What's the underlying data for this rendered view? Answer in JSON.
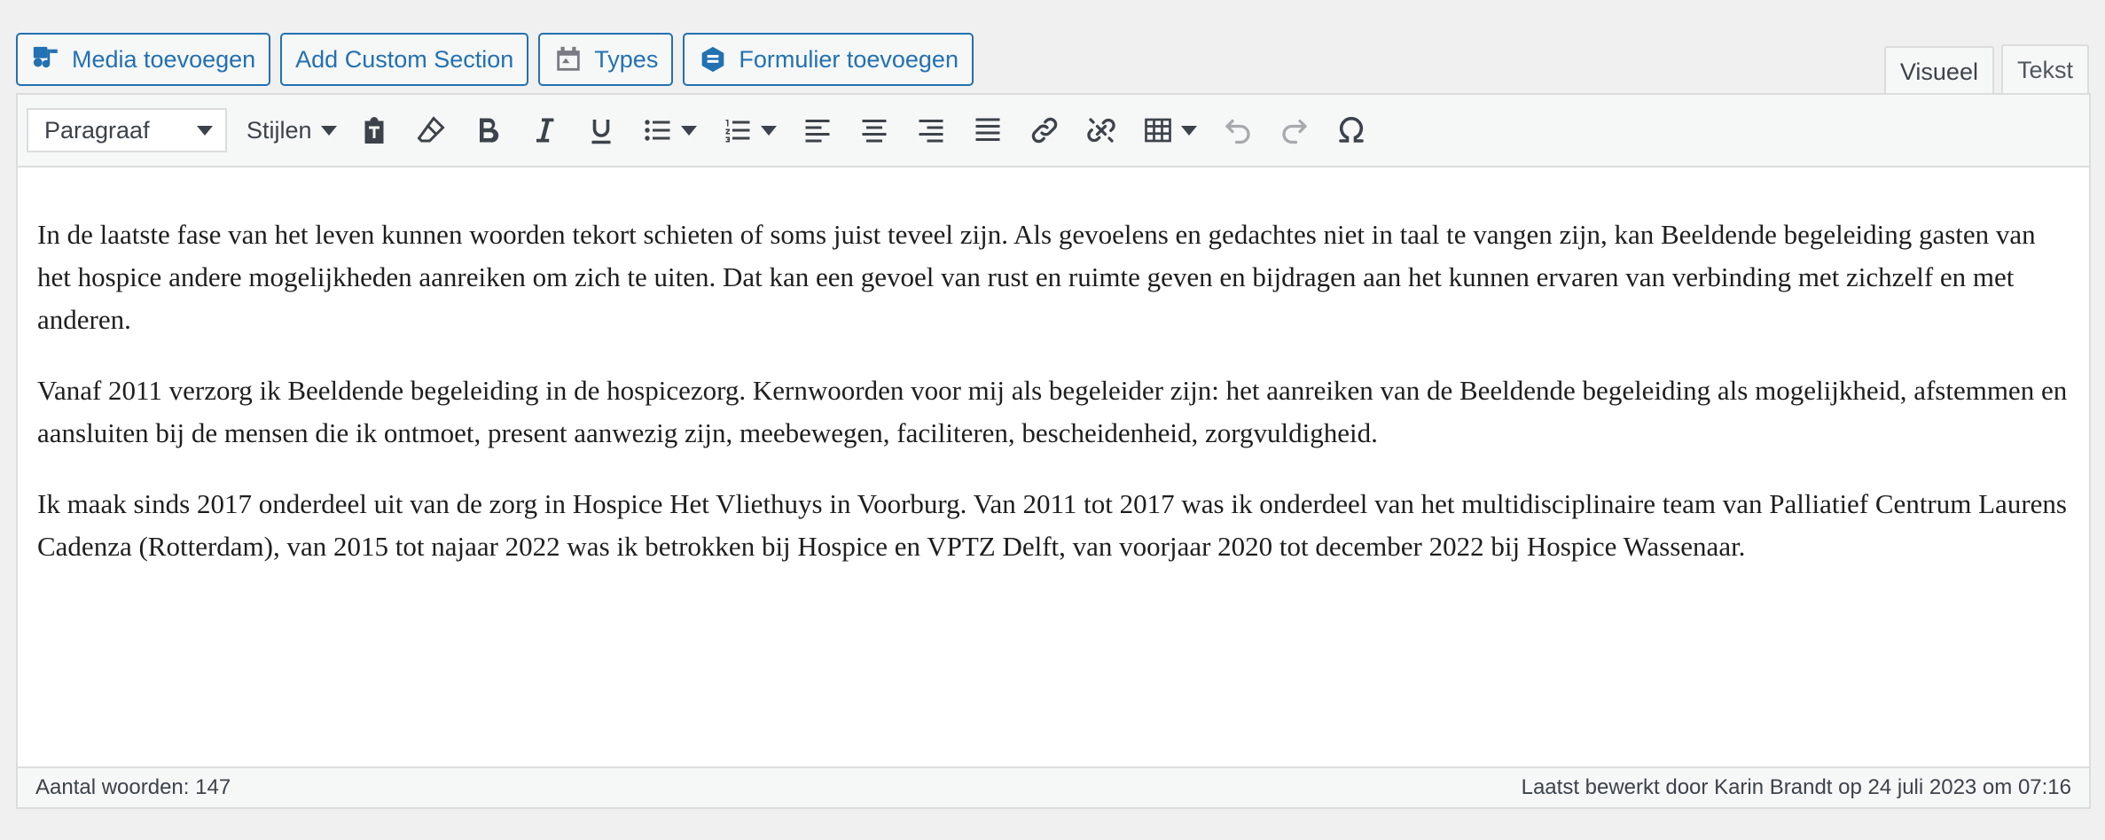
{
  "media_buttons": {
    "add_media": "Media toevoegen",
    "custom_section": "Add Custom Section",
    "types": "Types",
    "add_form": "Formulier toevoegen"
  },
  "tabs": {
    "visual": "Visueel",
    "text": "Tekst",
    "active": "Visueel"
  },
  "toolbar": {
    "format_select": "Paragraaf",
    "styles": "Stijlen",
    "icons": [
      "paste-icon",
      "eraser-icon",
      "bold-icon",
      "italic-icon",
      "underline-icon",
      "bullet-list-icon",
      "numbered-list-icon",
      "align-left-icon",
      "align-center-icon",
      "align-right-icon",
      "justify-icon",
      "link-icon",
      "unlink-icon",
      "table-icon",
      "undo-icon",
      "redo-icon",
      "omega-icon"
    ]
  },
  "content": {
    "paragraphs": [
      "In de laatste fase van het leven kunnen woorden tekort schieten of soms juist teveel zijn. Als gevoelens en gedachtes niet in taal te vangen zijn, kan Beeldende begeleiding gasten van het hospice andere mogelijkheden aanreiken om zich te uiten. Dat kan een gevoel van rust en ruimte geven en bijdragen aan het kunnen ervaren van verbinding met zichzelf en met anderen.",
      "Vanaf 2011 verzorg ik Beeldende begeleiding in de hospicezorg. Kernwoorden voor mij als begeleider zijn: het aanreiken van de Beeldende begeleiding als mogelijkheid, afstemmen en aansluiten bij de mensen die ik ontmoet, present aanwezig zijn, meebewegen, faciliteren, bescheidenheid, zorgvuldigheid.",
      "Ik maak sinds 2017 onderdeel uit van de zorg in Hospice Het Vliethuys in Voorburg. Van 2011 tot 2017 was ik onderdeel van het multidisciplinaire team van Palliatief Centrum Laurens Cadenza (Rotterdam), van 2015 tot najaar 2022 was ik betrokken bij Hospice en VPTZ Delft, van voorjaar 2020 tot december 2022 bij Hospice Wassenaar."
    ]
  },
  "status": {
    "word_count": "Aantal woorden: 147",
    "last_edited": "Laatst bewerkt door Karin Brandt op 24 juli 2023 om 07:16"
  },
  "colors": {
    "accent": "#2271b1",
    "background": "#f0f0f1",
    "toolbar": "#f6f7f7",
    "border": "#dcdcde"
  }
}
